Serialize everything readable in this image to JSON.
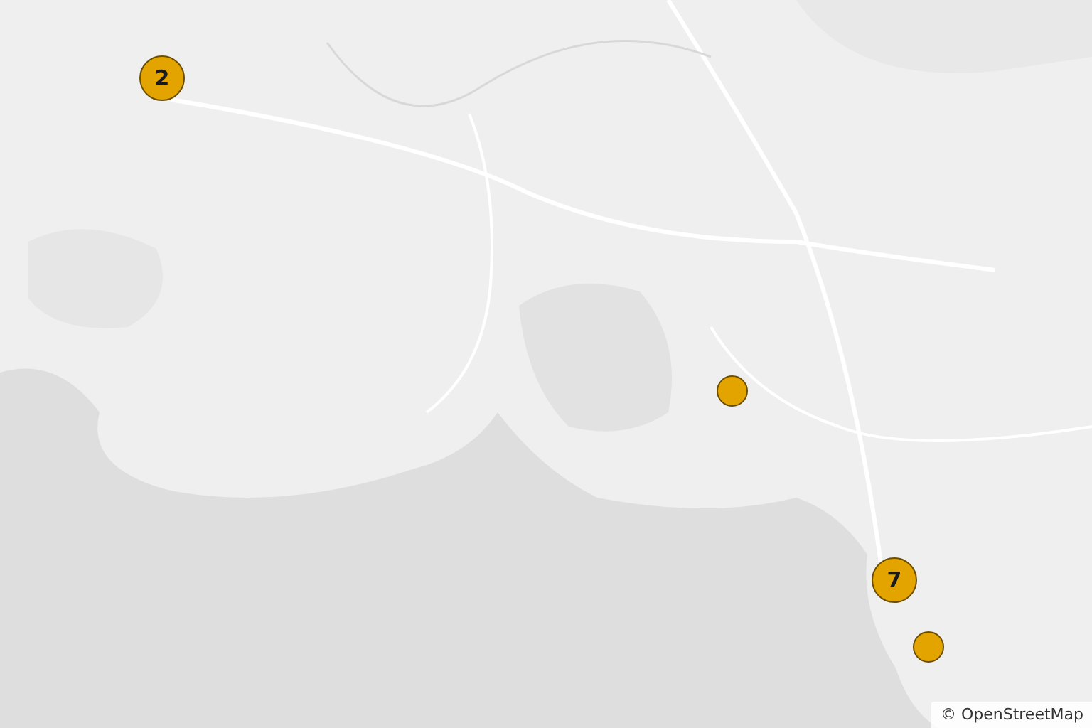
{
  "markers": [
    {
      "kind": "cluster",
      "count": "2"
    },
    {
      "kind": "point"
    },
    {
      "kind": "cluster",
      "count": "7"
    },
    {
      "kind": "point"
    }
  ],
  "attribution": "© OpenStreetMap"
}
